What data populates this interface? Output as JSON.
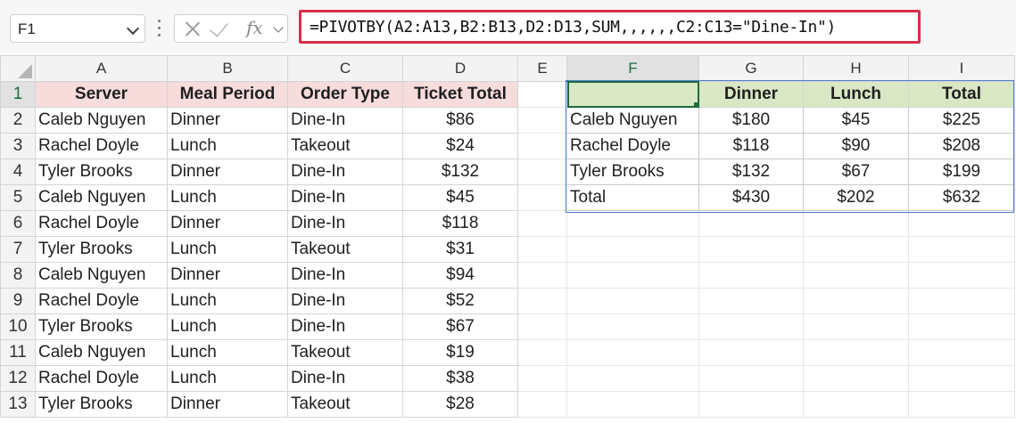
{
  "name_box": "F1",
  "formula": "=PIVOTBY(A2:A13,B2:B13,D2:D13,SUM,,,,,,C2:C13=\"Dine-In\")",
  "fx_label": "fx",
  "columns": [
    "A",
    "B",
    "C",
    "D",
    "E",
    "F",
    "G",
    "H",
    "I"
  ],
  "rows": [
    {
      "num": "1",
      "cells": [
        "Server",
        "Meal Period",
        "Order Type",
        "Ticket Total",
        "",
        "",
        "Dinner",
        "Lunch",
        "Total"
      ]
    },
    {
      "num": "2",
      "cells": [
        "Caleb Nguyen",
        "Dinner",
        "Dine-In",
        "$86",
        "",
        "Caleb Nguyen",
        "$180",
        "$45",
        "$225"
      ]
    },
    {
      "num": "3",
      "cells": [
        "Rachel Doyle",
        "Lunch",
        "Takeout",
        "$24",
        "",
        "Rachel Doyle",
        "$118",
        "$90",
        "$208"
      ]
    },
    {
      "num": "4",
      "cells": [
        "Tyler Brooks",
        "Dinner",
        "Dine-In",
        "$132",
        "",
        "Tyler Brooks",
        "$132",
        "$67",
        "$199"
      ]
    },
    {
      "num": "5",
      "cells": [
        "Caleb Nguyen",
        "Lunch",
        "Dine-In",
        "$45",
        "",
        "Total",
        "$430",
        "$202",
        "$632"
      ]
    },
    {
      "num": "6",
      "cells": [
        "Rachel Doyle",
        "Dinner",
        "Dine-In",
        "$118",
        "",
        "",
        "",
        "",
        ""
      ]
    },
    {
      "num": "7",
      "cells": [
        "Tyler Brooks",
        "Lunch",
        "Takeout",
        "$31",
        "",
        "",
        "",
        "",
        ""
      ]
    },
    {
      "num": "8",
      "cells": [
        "Caleb Nguyen",
        "Dinner",
        "Dine-In",
        "$94",
        "",
        "",
        "",
        "",
        ""
      ]
    },
    {
      "num": "9",
      "cells": [
        "Rachel Doyle",
        "Lunch",
        "Dine-In",
        "$52",
        "",
        "",
        "",
        "",
        ""
      ]
    },
    {
      "num": "10",
      "cells": [
        "Tyler Brooks",
        "Lunch",
        "Dine-In",
        "$67",
        "",
        "",
        "",
        "",
        ""
      ]
    },
    {
      "num": "11",
      "cells": [
        "Caleb Nguyen",
        "Lunch",
        "Takeout",
        "$19",
        "",
        "",
        "",
        "",
        ""
      ]
    },
    {
      "num": "12",
      "cells": [
        "Rachel Doyle",
        "Lunch",
        "Dine-In",
        "$38",
        "",
        "",
        "",
        "",
        ""
      ]
    },
    {
      "num": "13",
      "cells": [
        "Tyler Brooks",
        "Dinner",
        "Takeout",
        "$28",
        "",
        "",
        "",
        "",
        ""
      ]
    }
  ],
  "colors": {
    "source_header_fill": "#f7dcdc",
    "pivot_header_fill": "#d9e7c4",
    "formula_highlight": "#d92d4a",
    "spill_border": "#4a7fd0",
    "selection": "#1d6b3e"
  },
  "icons": {
    "cancel": "x-icon",
    "enter": "check-icon",
    "function": "fx-icon",
    "dropdown": "chevron-down-icon"
  }
}
